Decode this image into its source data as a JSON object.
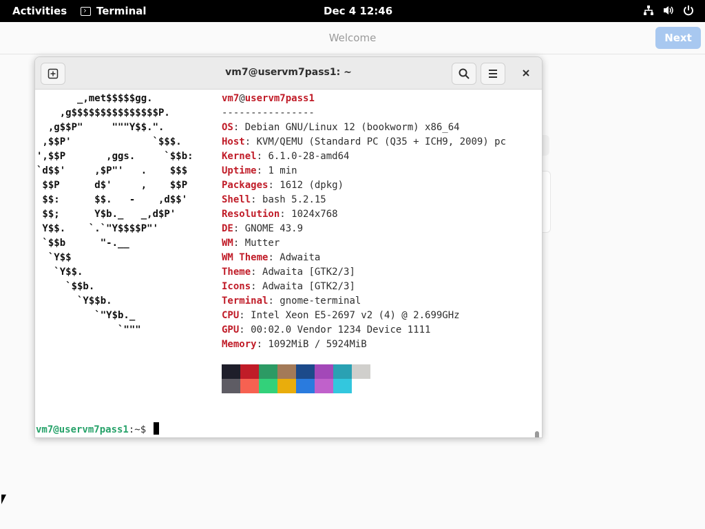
{
  "topbar": {
    "activities": "Activities",
    "app_name": "Terminal",
    "clock": "Dec 4  12:46",
    "icons": [
      "network-icon",
      "volume-icon",
      "power-icon"
    ]
  },
  "welcome": {
    "title": "Welcome",
    "next_label": "Next",
    "next_color": "#a8c8f0"
  },
  "terminal": {
    "title": "vm7@uservm7pass1: ~",
    "new_tab_icon": "new-tab-icon",
    "search_icon": "search-icon",
    "menu_icon": "hamburger-menu-icon",
    "close_icon": "close-icon",
    "user": "vm7",
    "at": "@",
    "host": "uservm7pass1",
    "separator": "----------------",
    "info": [
      {
        "key": "OS",
        "value": "Debian GNU/Linux 12 (bookworm) x86_64"
      },
      {
        "key": "Host",
        "value": "KVM/QEMU (Standard PC (Q35 + ICH9, 2009) pc"
      },
      {
        "key": "Kernel",
        "value": "6.1.0-28-amd64"
      },
      {
        "key": "Uptime",
        "value": "1 min"
      },
      {
        "key": "Packages",
        "value": "1612 (dpkg)"
      },
      {
        "key": "Shell",
        "value": "bash 5.2.15"
      },
      {
        "key": "Resolution",
        "value": "1024x768"
      },
      {
        "key": "DE",
        "value": "GNOME 43.9"
      },
      {
        "key": "WM",
        "value": "Mutter"
      },
      {
        "key": "WM Theme",
        "value": "Adwaita"
      },
      {
        "key": "Theme",
        "value": "Adwaita [GTK2/3]"
      },
      {
        "key": "Icons",
        "value": "Adwaita [GTK2/3]"
      },
      {
        "key": "Terminal",
        "value": "gnome-terminal"
      },
      {
        "key": "CPU",
        "value": "Intel Xeon E5-2697 v2 (4) @ 2.699GHz"
      },
      {
        "key": "GPU",
        "value": "00:02.0 Vendor 1234 Device 1111"
      },
      {
        "key": "Memory",
        "value": "1092MiB / 5924MiB"
      }
    ],
    "palette_row1": [
      "#1e1e2a",
      "#c01c28",
      "#2c9a64",
      "#a37a58",
      "#1c4a8a",
      "#a348b8",
      "#2aa1b3",
      "#d0cfcc"
    ],
    "palette_row2": [
      "#5e5c64",
      "#f66151",
      "#33d17a",
      "#e9ad0c",
      "#2a7bde",
      "#c061cb",
      "#33c7de",
      "#ffffff"
    ],
    "prompt_user": "vm7@uservm7pass1",
    "prompt_dir": ":~$ ",
    "ascii_art": [
      "       _,met$$$$$gg.",
      "    ,g$$$$$$$$$$$$$$$P.",
      "  ,g$$P\"     \"\"\"Y$$.\".",
      " ,$$P'              `$$$.",
      "',$$P       ,ggs.     `$$b:",
      "`d$$'     ,$P\"'   .    $$$",
      " $$P      d$'     ,    $$P",
      " $$:      $$.   -    ,d$$'",
      " $$;      Y$b._   _,d$P'",
      " Y$$.    `.`\"Y$$$$P\"'",
      " `$$b      \"-.__",
      "  `Y$$",
      "   `Y$$.",
      "     `$$b.",
      "       `Y$$b.",
      "          `\"Y$b._",
      "              `\"\"\""
    ]
  }
}
